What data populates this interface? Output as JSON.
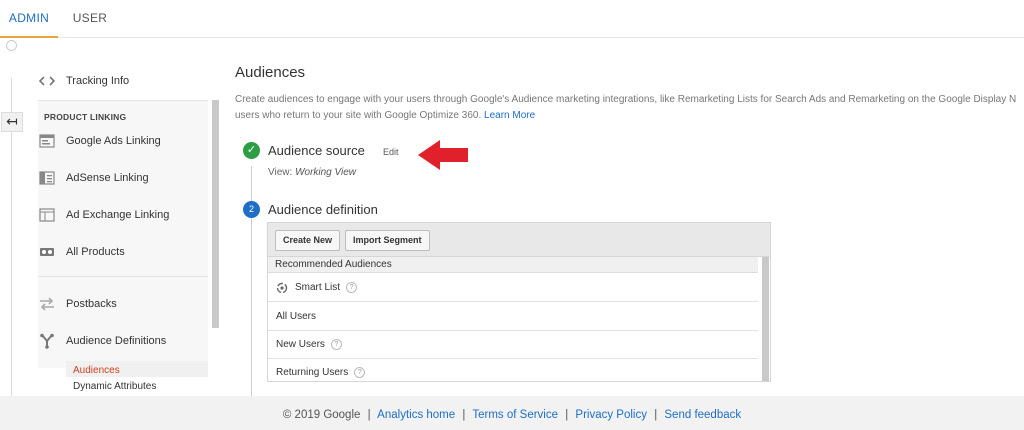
{
  "tabs": {
    "admin": "ADMIN",
    "user": "USER"
  },
  "rail": {
    "back_glyph": "↤"
  },
  "sidebar": {
    "tracking_info": "Tracking Info",
    "section_product_linking": "PRODUCT LINKING",
    "google_ads_linking": "Google Ads Linking",
    "adsense_linking": "AdSense Linking",
    "ad_exchange_linking": "Ad Exchange Linking",
    "all_products": "All Products",
    "postbacks": "Postbacks",
    "audience_definitions": "Audience Definitions",
    "sub_audiences": "Audiences",
    "sub_dynamic_attributes": "Dynamic Attributes"
  },
  "main": {
    "title": "Audiences",
    "description_line1": "Create audiences to engage with your users through Google's Audience marketing integrations, like Remarketing Lists for Search Ads and Remarketing on the Google Display N",
    "description_line2": "users who return to your site with Google Optimize 360. ",
    "learn_more": "Learn More",
    "step1": {
      "title": "Audience source",
      "edit": "Edit",
      "view_label": "View: ",
      "view_value": "Working View"
    },
    "step2": {
      "number": "2",
      "title": "Audience definition"
    },
    "buttons": {
      "create_new": "Create New",
      "import_segment": "Import Segment"
    },
    "recommended_header": "Recommended Audiences",
    "rows": [
      "Smart List",
      "All Users",
      "New Users",
      "Returning Users"
    ],
    "help_glyph": "?"
  },
  "footer": {
    "copyright": "© 2019 Google",
    "links": [
      "Analytics home",
      "Terms of Service",
      "Privacy Policy",
      "Send feedback"
    ],
    "separator": "|"
  },
  "colors": {
    "accent": "#1e6ec8",
    "active_tab_underline": "#e8a33d",
    "success": "#2e9e46",
    "active_item": "#d4401f",
    "arrow": "#e0202a"
  }
}
